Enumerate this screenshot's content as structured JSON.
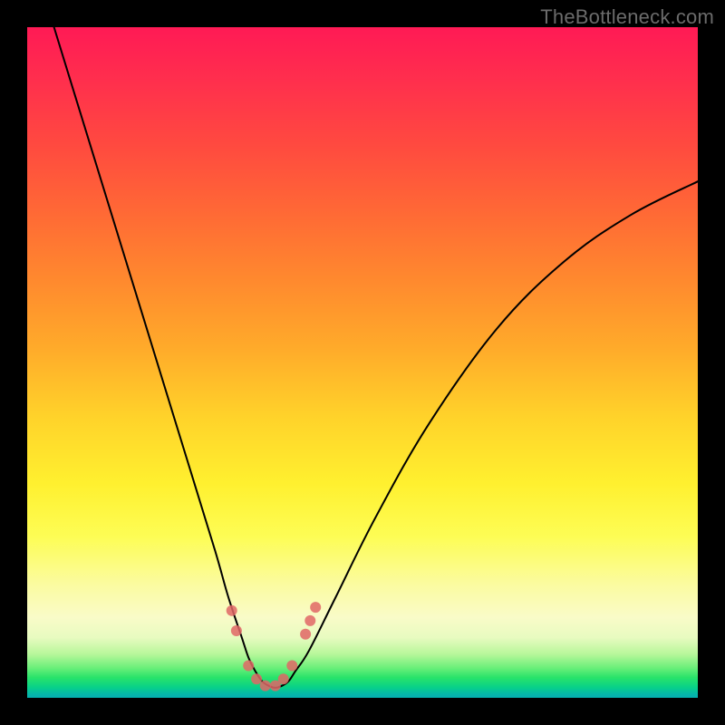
{
  "watermark": {
    "text": "TheBottleneck.com"
  },
  "chart_data": {
    "type": "line",
    "title": "",
    "xlabel": "",
    "ylabel": "",
    "xlim": [
      0,
      100
    ],
    "ylim": [
      0,
      100
    ],
    "grid": false,
    "legend": false,
    "background_gradient": {
      "orientation": "vertical",
      "stops": [
        {
          "pct": 0,
          "color": "#ff1a55"
        },
        {
          "pct": 18,
          "color": "#ff4b3f"
        },
        {
          "pct": 38,
          "color": "#ff8a2e"
        },
        {
          "pct": 58,
          "color": "#ffd22a"
        },
        {
          "pct": 76,
          "color": "#fdfd55"
        },
        {
          "pct": 88,
          "color": "#f9fbc8"
        },
        {
          "pct": 95.5,
          "color": "#6cef7a"
        },
        {
          "pct": 98.5,
          "color": "#07d08a"
        },
        {
          "pct": 100,
          "color": "#05b0b0"
        }
      ]
    },
    "series": [
      {
        "name": "bottleneck-curve",
        "color": "#000000",
        "stroke_width": 2,
        "x": [
          4,
          8,
          12,
          16,
          20,
          24,
          28,
          30,
          32,
          33,
          34,
          35,
          36,
          37,
          38,
          39,
          40,
          42,
          46,
          52,
          60,
          70,
          80,
          90,
          100
        ],
        "y": [
          100,
          87,
          74,
          61,
          48,
          35,
          22,
          15,
          9,
          6,
          4,
          2.5,
          1.8,
          1.5,
          1.8,
          2.5,
          4,
          7,
          15,
          27,
          41,
          55,
          65,
          72,
          77
        ]
      }
    ],
    "markers": {
      "name": "highlight-dots",
      "color": "#e06666",
      "radius": 6,
      "points": [
        {
          "x": 30.5,
          "y": 13
        },
        {
          "x": 31.2,
          "y": 10
        },
        {
          "x": 33.0,
          "y": 4.8
        },
        {
          "x": 34.2,
          "y": 2.8
        },
        {
          "x": 35.5,
          "y": 1.8
        },
        {
          "x": 37.0,
          "y": 1.8
        },
        {
          "x": 38.2,
          "y": 2.8
        },
        {
          "x": 39.5,
          "y": 4.8
        },
        {
          "x": 41.5,
          "y": 9.5
        },
        {
          "x": 42.2,
          "y": 11.5
        },
        {
          "x": 43.0,
          "y": 13.5
        }
      ]
    }
  }
}
